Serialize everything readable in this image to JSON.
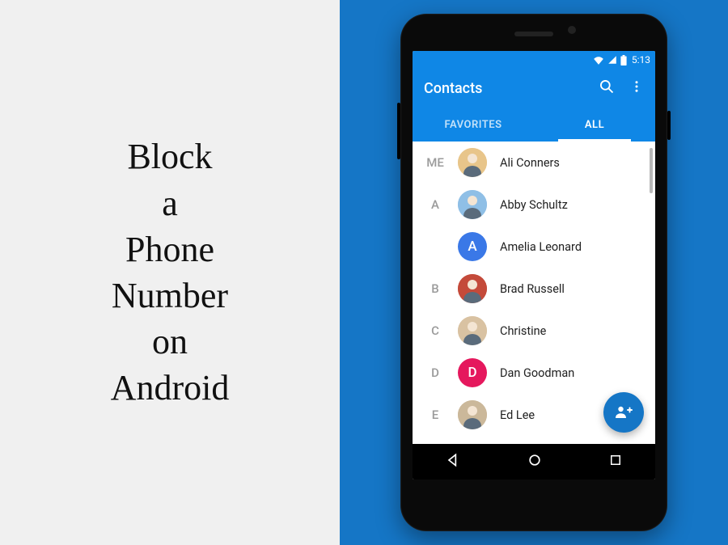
{
  "headline": {
    "line1": "Block",
    "line2": "a",
    "line3": "Phone",
    "line4": "Number",
    "line5": "on",
    "line6": "Android"
  },
  "status": {
    "time": "5:13"
  },
  "appbar": {
    "title": "Contacts"
  },
  "tabs": {
    "favorites": "FAVORITES",
    "all": "ALL"
  },
  "sections": [
    {
      "letter": "ME",
      "contacts": [
        {
          "name": "Ali Conners",
          "avatar_type": "photo",
          "bg": "#e8c58a"
        }
      ]
    },
    {
      "letter": "A",
      "contacts": [
        {
          "name": "Abby Schultz",
          "avatar_type": "photo",
          "bg": "#8fbfe6"
        },
        {
          "name": "Amelia Leonard",
          "avatar_type": "letter",
          "initial": "A",
          "bg": "#3a78e7"
        }
      ]
    },
    {
      "letter": "B",
      "contacts": [
        {
          "name": "Brad Russell",
          "avatar_type": "photo",
          "bg": "#c44a3a"
        }
      ]
    },
    {
      "letter": "C",
      "contacts": [
        {
          "name": "Christine",
          "avatar_type": "photo",
          "bg": "#d9c2a2"
        }
      ]
    },
    {
      "letter": "D",
      "contacts": [
        {
          "name": "Dan Goodman",
          "avatar_type": "letter",
          "initial": "D",
          "bg": "#e5185d"
        }
      ]
    },
    {
      "letter": "E",
      "contacts": [
        {
          "name": "Ed Lee",
          "avatar_type": "photo",
          "bg": "#cbb89a"
        }
      ]
    }
  ]
}
